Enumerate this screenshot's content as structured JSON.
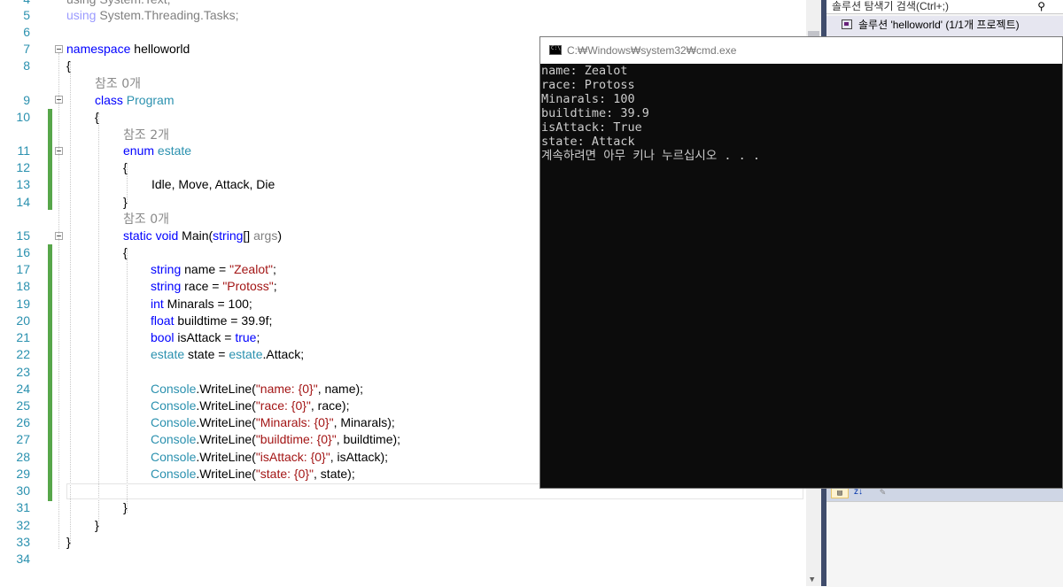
{
  "editor": {
    "line_numbers": [
      "4",
      "5",
      "6",
      "7",
      "8",
      "",
      "9",
      "10",
      "",
      "11",
      "12",
      "13",
      "14",
      "",
      "15",
      "16",
      "17",
      "18",
      "19",
      "20",
      "21",
      "22",
      "23",
      "24",
      "25",
      "26",
      "27",
      "28",
      "29",
      "30",
      "31",
      "32",
      "33",
      "34"
    ],
    "codelens": {
      "ref0_ns": "참조 0개",
      "ref2_enum": "참조 2개",
      "ref0_main": "참조 0개"
    },
    "lines": {
      "l4": "using System.Text;",
      "l5a": "using",
      "l5b": " System.Threading.Tasks;",
      "l7a": "namespace",
      "l7b": " helloworld",
      "l8": "{",
      "l9a": "class",
      "l9b": " Program",
      "l10": "{",
      "l11a": "enum",
      "l11b": " estate",
      "l12": "{",
      "l13": "Idle, Move, Attack, Die",
      "l14": "}",
      "l15a": "static",
      "l15b": " void",
      "l15c": " Main(",
      "l15d": "string",
      "l15e": "[] ",
      "l15f": "args",
      "l15g": ")",
      "l16": "{",
      "l17a": "string",
      "l17b": " name = ",
      "l17c": "\"Zealot\"",
      "l17d": ";",
      "l18a": "string",
      "l18b": " race = ",
      "l18c": "\"Protoss\"",
      "l18d": ";",
      "l19a": "int",
      "l19b": " Minarals = 100;",
      "l20a": "float",
      "l20b": " buildtime = 39.9f;",
      "l21a": "bool",
      "l21b": " isAttack = ",
      "l21c": "true",
      "l21d": ";",
      "l22a": "estate",
      "l22b": " state = ",
      "l22c": "estate",
      "l22d": ".Attack;",
      "l24a": "Console",
      "l24b": ".WriteLine(",
      "l24c": "\"name: {0}\"",
      "l24d": ", name);",
      "l25a": "Console",
      "l25b": ".WriteLine(",
      "l25c": "\"race: {0}\"",
      "l25d": ", race);",
      "l26a": "Console",
      "l26b": ".WriteLine(",
      "l26c": "\"Minarals: {0}\"",
      "l26d": ", Minarals);",
      "l27a": "Console",
      "l27b": ".WriteLine(",
      "l27c": "\"buildtime: {0}\"",
      "l27d": ", buildtime);",
      "l28a": "Console",
      "l28b": ".WriteLine(",
      "l28c": "\"isAttack: {0}\"",
      "l28d": ", isAttack);",
      "l29a": "Console",
      "l29b": ".WriteLine(",
      "l29c": "\"state: {0}\"",
      "l29d": ", state);",
      "l31": "}",
      "l32": "}",
      "l33": "}"
    }
  },
  "solution_explorer": {
    "search_placeholder": "솔루션 탐색기 검색(Ctrl+;)",
    "search_icon": "search-icon",
    "solution_label": "솔루션 'helloworld' (1/1개 프로젝트)"
  },
  "properties_toolbar": {
    "categorized_icon": "categorized-icon",
    "alpha_label": "z↓",
    "wrench_icon": "wrench-icon"
  },
  "console": {
    "title": "C:₩Windows₩system32₩cmd.exe",
    "output": [
      "name: Zealot",
      "race: Protoss",
      "Minarals: 100",
      "buildtime: 39.9",
      "isAttack: True",
      "state: Attack",
      "계속하려면 아무 키나 누르십시오 . . ."
    ]
  },
  "colors": {
    "keyword": "#0000ff",
    "type": "#2b91af",
    "string": "#a31515",
    "console_bg": "#0c0c0c",
    "console_text": "#cccccc",
    "change_bar": "#57a64a"
  }
}
